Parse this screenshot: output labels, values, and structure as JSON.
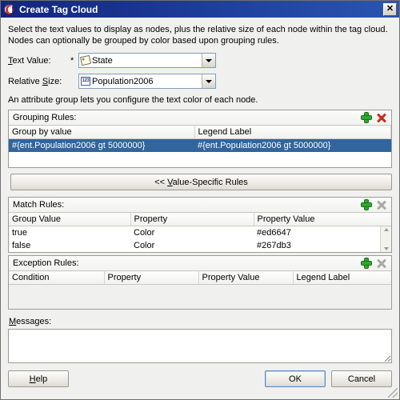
{
  "window": {
    "title": "Create Tag Cloud",
    "icon": "app-emblem-icon",
    "close_label": "✕"
  },
  "instructions": "Select the text values to display as nodes, plus the relative size of each node within the tag cloud. Nodes can optionally be grouped by color based upon grouping rules.",
  "fields": {
    "text_value": {
      "label": "Text Value:",
      "required_marker": "*",
      "value": "State",
      "value_icon": "tag-icon"
    },
    "relative_size": {
      "label": "Relative Size:",
      "value": "Population2006",
      "value_icon": "number-123-icon"
    }
  },
  "attribute_note": "An attribute group lets you configure the text color of each node.",
  "grouping_rules": {
    "title": "Grouping Rules:",
    "add_icon": "plus-icon",
    "delete_icon": "delete-x-icon",
    "delete_enabled": true,
    "columns": [
      "Group by value",
      "Legend Label"
    ],
    "rows": [
      {
        "group_by_value": "#{ent.Population2006 gt 5000000}",
        "legend_label": "#{ent.Population2006 gt 5000000}",
        "selected": true
      }
    ]
  },
  "value_specific_rules_button": {
    "prefix": "<< ",
    "mnemonic": "V",
    "rest": "alue-Specific Rules"
  },
  "match_rules": {
    "title": "Match Rules:",
    "add_icon": "plus-icon",
    "delete_icon": "delete-x-icon",
    "delete_enabled": false,
    "columns": [
      "Group Value",
      "Property",
      "Property Value"
    ],
    "rows": [
      {
        "group_value": "true",
        "property": "Color",
        "property_value": "#ed6647"
      },
      {
        "group_value": "false",
        "property": "Color",
        "property_value": "#267db3"
      }
    ]
  },
  "exception_rules": {
    "title": "Exception Rules:",
    "add_icon": "plus-icon",
    "delete_icon": "delete-x-icon",
    "delete_enabled": false,
    "columns": [
      "Condition",
      "Property",
      "Property Value",
      "Legend Label"
    ],
    "rows": []
  },
  "messages": {
    "label_mnemonic": "M",
    "label_rest": "essages:",
    "value": ""
  },
  "footer": {
    "help_mnemonic": "H",
    "help_rest": "elp",
    "ok_label": "OK",
    "cancel_label": "Cancel",
    "focused_button": "ok"
  },
  "colors": {
    "titlebar_start": "#12257b",
    "titlebar_end": "#2a56b0",
    "selection": "#31659c",
    "dialog_bg": "#f0f0ee",
    "rule_true_color": "#ed6647",
    "rule_false_color": "#267db3"
  }
}
